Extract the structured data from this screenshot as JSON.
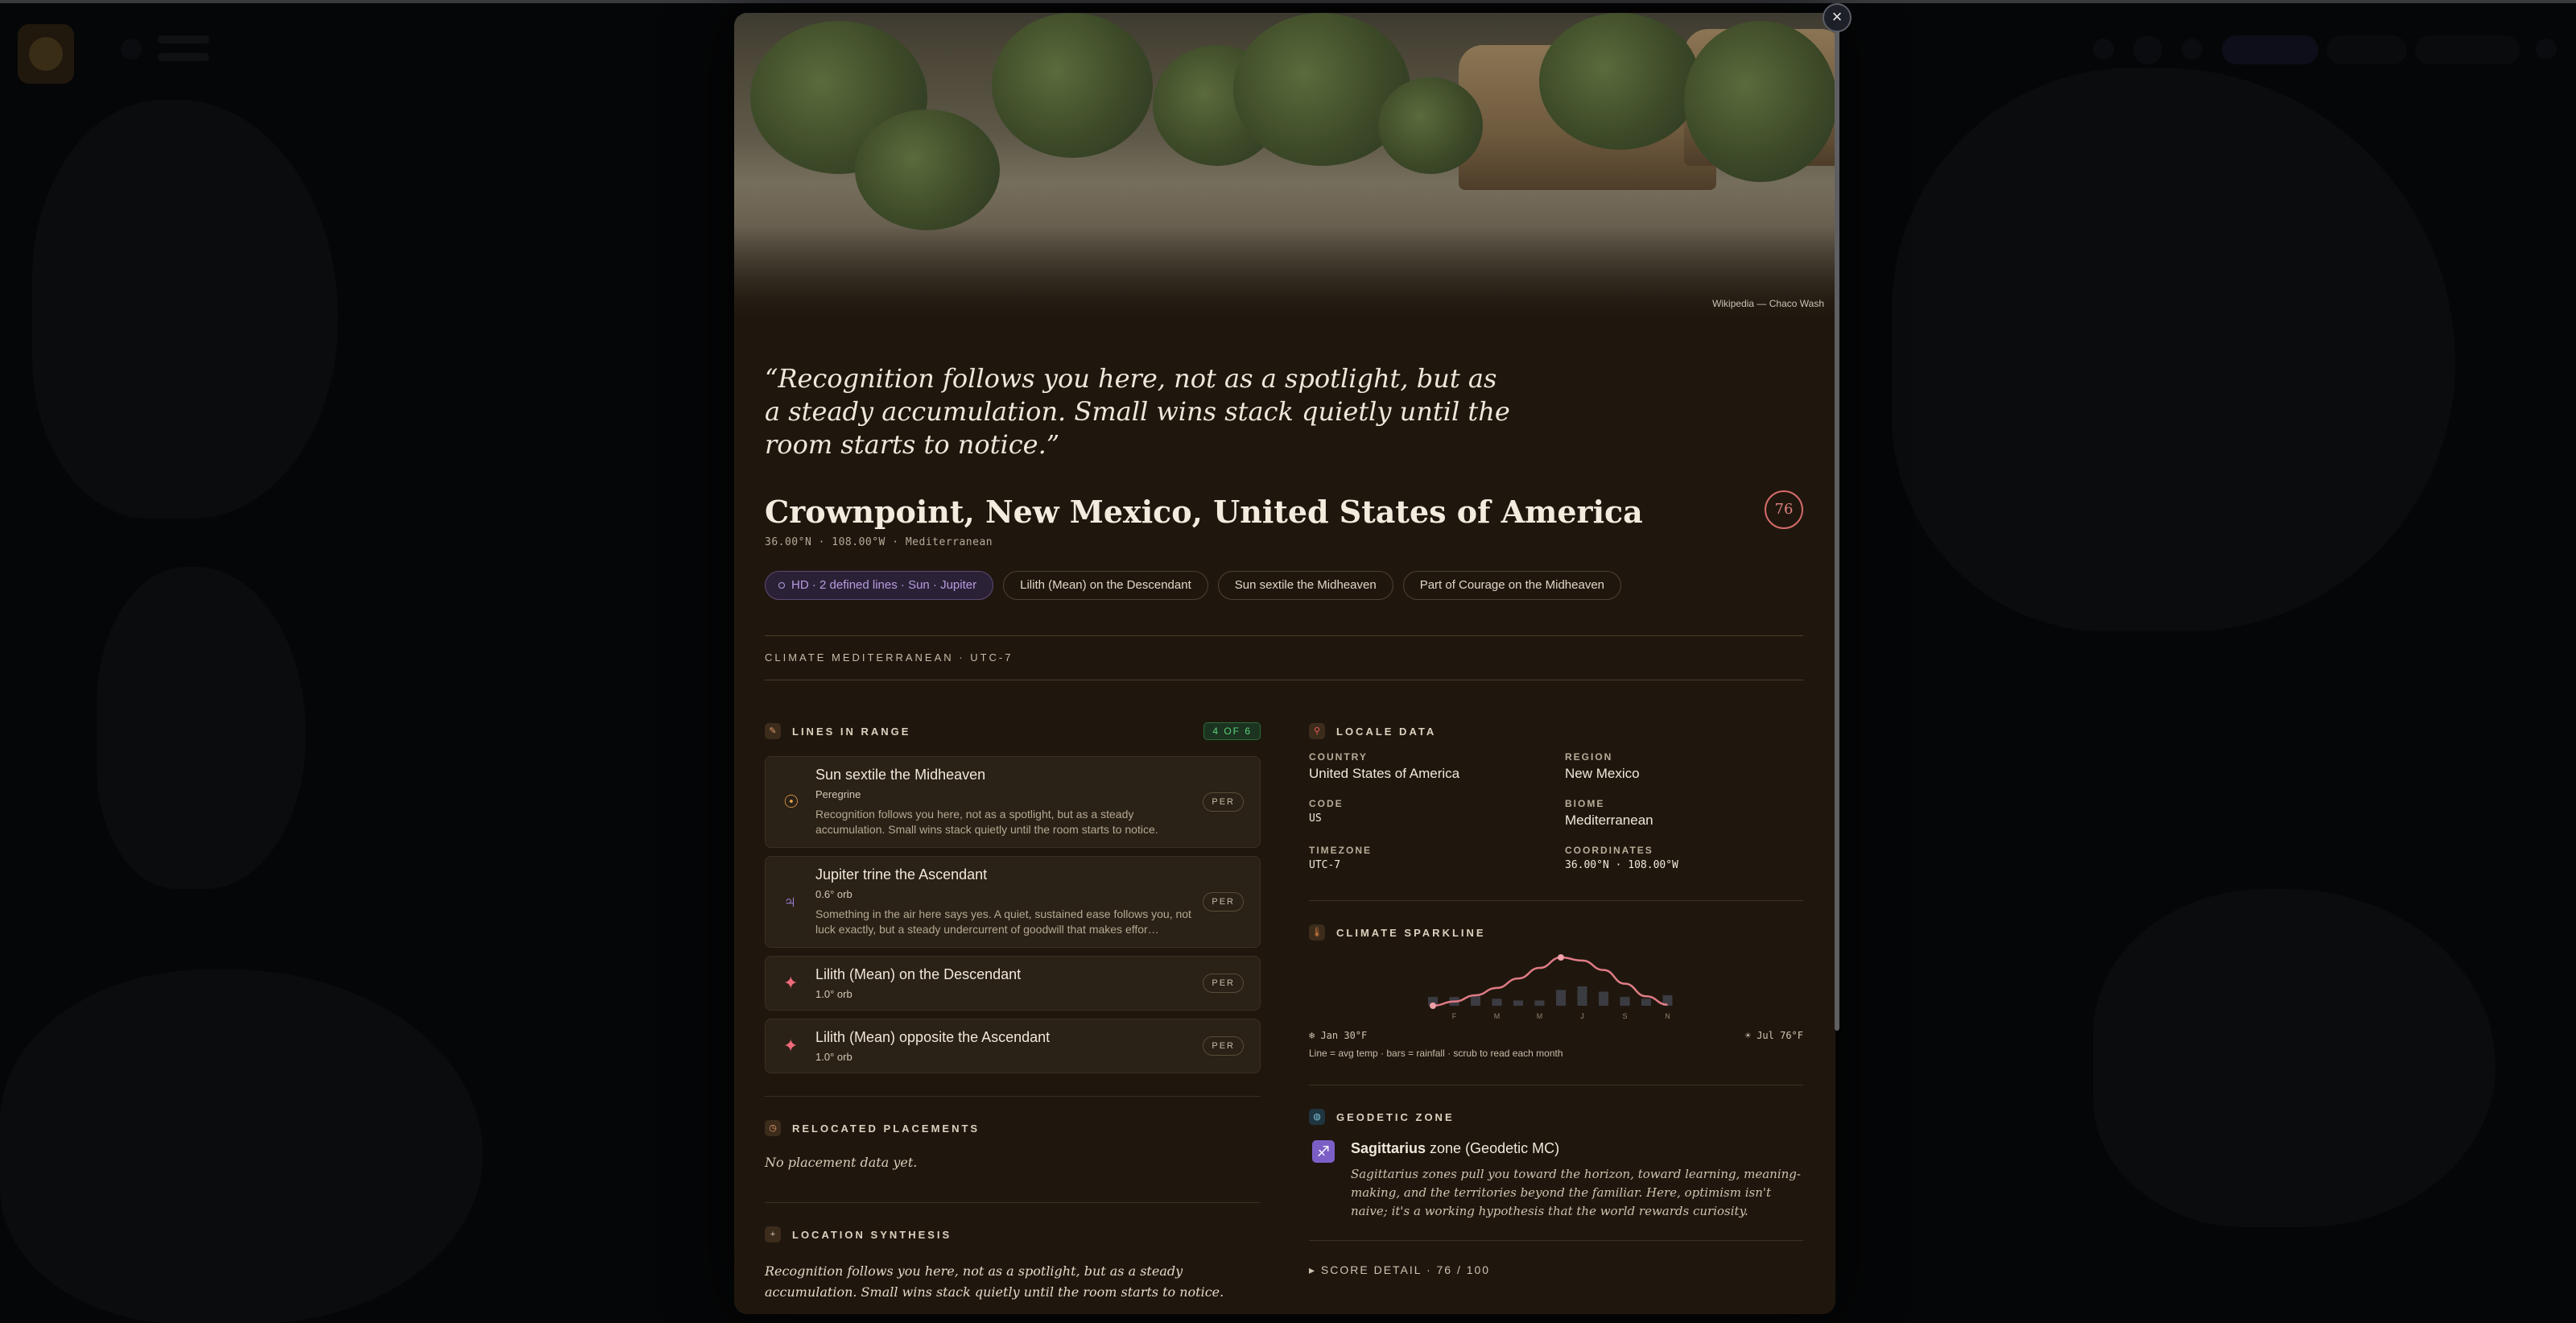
{
  "hero": {
    "credit": "Wikipedia — Chaco Wash"
  },
  "close_label": "×",
  "quote": "“Recognition follows you here, not as a spotlight, but as a steady accumulation. Small wins stack quietly until the room starts to notice.”",
  "location": {
    "title": "Crownpoint, New Mexico, United States of America",
    "meta": "36.00°N · 108.00°W · Mediterranean",
    "score": "76"
  },
  "chips": [
    {
      "label": "HD · 2 defined lines · Sun · Jupiter",
      "kind": "hd"
    },
    {
      "label": "Lilith (Mean) on the Descendant",
      "kind": "line"
    },
    {
      "label": "Sun sextile the Midheaven",
      "kind": "line"
    },
    {
      "label": "Part of Courage on the Midheaven",
      "kind": "line"
    }
  ],
  "climate_label": "CLIMATE MEDITERRANEAN · UTC-7",
  "lines_in_range": {
    "label": "LINES IN RANGE",
    "badge": "4 OF 6",
    "icon": "pencil-icon",
    "items": [
      {
        "glyph": "☉",
        "glyph_color": "#e4a04a",
        "title": "Sun sextile the Midheaven",
        "sub": "Peregrine",
        "desc": "Recognition follows you here, not as a spotlight, but as a steady accumulation. Small wins stack quietly until the room starts to notice.",
        "tag": "PER"
      },
      {
        "glyph": "♃",
        "glyph_color": "#a98ae8",
        "title": "Jupiter trine the Ascendant",
        "sub": "0.6° orb",
        "desc": "Something in the air here says yes. A quiet, sustained ease follows you, not luck exactly, but a steady undercurrent of goodwill that makes effor…",
        "tag": "PER"
      },
      {
        "glyph": "✦",
        "glyph_color": "#ef6b7c",
        "title": "Lilith (Mean) on the Descendant",
        "sub": "1.0° orb",
        "desc": "",
        "tag": "PER"
      },
      {
        "glyph": "✦",
        "glyph_color": "#ef6b7c",
        "title": "Lilith (Mean) opposite the Ascendant",
        "sub": "1.0° orb",
        "desc": "",
        "tag": "PER"
      }
    ]
  },
  "relocated": {
    "label": "RELOCATED PLACEMENTS",
    "empty": "No placement data yet."
  },
  "synthesis": {
    "label": "LOCATION SYNTHESIS",
    "text": "Recognition follows you here, not as a spotlight, but as a steady accumulation. Small wins stack quietly until the room starts to notice."
  },
  "locale": {
    "label": "LOCALE DATA",
    "country_label": "COUNTRY",
    "country": "United States of America",
    "region_label": "REGION",
    "region": "New Mexico",
    "code_label": "CODE",
    "code": "US",
    "biome_label": "BIOME",
    "biome": "Mediterranean",
    "timezone_label": "TIMEZONE",
    "timezone": "UTC-7",
    "coords_label": "COORDINATES",
    "coords": "36.00°N · 108.00°W"
  },
  "climate_sparkline": {
    "label": "CLIMATE SPARKLINE",
    "min_label": "Jan 30°F",
    "max_label": "Jul 76°F",
    "note": "Line = avg temp · bars = rainfall · scrub to read each month",
    "month_ticks": [
      "F",
      "M",
      "M",
      "J",
      "S",
      "N"
    ]
  },
  "chart_data": {
    "type": "line",
    "x": [
      "Jan",
      "Feb",
      "Mar",
      "Apr",
      "May",
      "Jun",
      "Jul",
      "Aug",
      "Sep",
      "Oct",
      "Nov",
      "Dec"
    ],
    "series": [
      {
        "values": [
          30,
          34,
          40,
          47,
          56,
          66,
          76,
          73,
          64,
          51,
          39,
          31
        ]
      },
      {
        "values": [
          0.5,
          0.5,
          0.6,
          0.4,
          0.3,
          0.3,
          0.9,
          1.1,
          0.8,
          0.5,
          0.4,
          0.6
        ]
      }
    ]
  },
  "geodetic": {
    "label": "GEODETIC ZONE",
    "sign_glyph": "♐",
    "sign": "Sagittarius",
    "suffix": " zone (Geodetic MC)",
    "desc": "Sagittarius zones pull you toward the horizon, toward learning, meaning-making, and the territories beyond the familiar. Here, optimism isn't naive; it's a working hypothesis that the world rewards curiosity."
  },
  "score_detail": "▸ SCORE DETAIL · 76 / 100"
}
